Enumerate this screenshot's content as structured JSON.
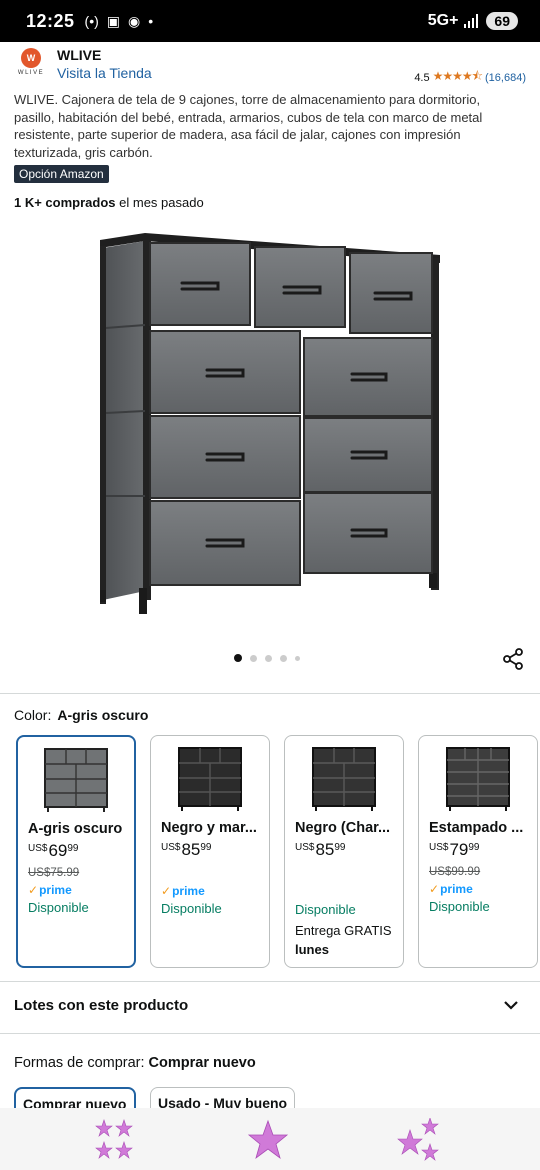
{
  "status_bar": {
    "time": "12:25",
    "network": "5G+",
    "battery": "69"
  },
  "brand": {
    "logo_text": "WLIVE",
    "name": "WLIVE",
    "visit_store": "Visita la Tienda"
  },
  "rating": {
    "value": "4.5",
    "stars": 4.5,
    "count": "(16,684)"
  },
  "product": {
    "title": "WLIVE. Cajonera de tela de 9 cajones, torre de almacenamiento para dormitorio, pasillo, habitación del bebé, entrada, armarios, cubos de tela con marco de metal resistente, parte superior de madera, asa fácil de jalar, cajones con impresión texturizada, gris carbón.",
    "badge": "Opción Amazon",
    "bought_bold": "1 K+ comprados",
    "bought_rest": "el mes pasado",
    "image_count": 5,
    "image_index": 1
  },
  "color": {
    "label": "Color:",
    "value": "A-gris oscuro"
  },
  "swatches": [
    {
      "name": "A-gris oscuro",
      "currency": "US$",
      "whole": "69",
      "cents": "99",
      "list_price": "US$75.99",
      "prime": "prime",
      "availability": "Disponible",
      "selected": true,
      "tone": "#6b6e70"
    },
    {
      "name": "Negro y mar...",
      "currency": "US$",
      "whole": "85",
      "cents": "99",
      "list_price": "",
      "prime": "prime",
      "availability": "Disponible",
      "selected": false,
      "tone": "#2a2a2a"
    },
    {
      "name": "Negro (Char...",
      "currency": "US$",
      "whole": "85",
      "cents": "99",
      "list_price": "",
      "prime": "",
      "availability": "Disponible",
      "delivery": "Entrega GRATIS",
      "delivery_day": "lunes",
      "selected": false,
      "tone": "#333333"
    },
    {
      "name": "Estampado ...",
      "currency": "US$",
      "whole": "79",
      "cents": "99",
      "list_price": "US$99.99",
      "prime": "prime",
      "availability": "Disponible",
      "selected": false,
      "tone": "#3a3a3a"
    }
  ],
  "bundles": {
    "label": "Lotes con este producto"
  },
  "buy": {
    "label": "Formas de comprar:",
    "value": "Comprar nuevo",
    "options": [
      "Comprar nuevo",
      "Usado - Muy bueno"
    ]
  },
  "colors": {
    "link": "#2162a1",
    "available": "#067d62",
    "star": "#de7921",
    "prime": "#1399ff",
    "badge_bg": "#232f3e"
  }
}
